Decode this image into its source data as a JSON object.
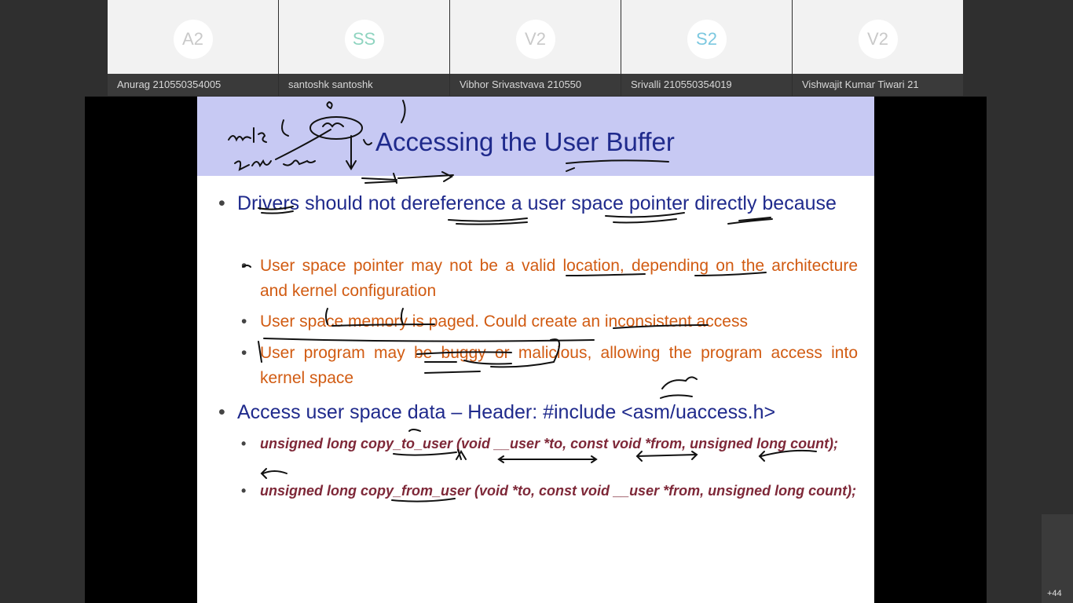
{
  "participants": [
    {
      "initials": "A2",
      "name": "Anurag 210550354005"
    },
    {
      "initials": "SS",
      "name": "santoshk santoshk"
    },
    {
      "initials": "V2",
      "name": "Vibhor Srivastvava 210550"
    },
    {
      "initials": "S2",
      "name": "Srivalli 210550354019"
    },
    {
      "initials": "V2",
      "name": "Vishwajit Kumar Tiwari 21"
    }
  ],
  "slide": {
    "title": "Accessing the User Buffer",
    "bullet1": "Drivers should not dereference a user space pointer directly because",
    "sub": [
      "User space pointer may not be a valid location, depending on the architecture and kernel configuration",
      "User space memory is paged. Could create an inconsistent access",
      "User program may be buggy or malicious, allowing the program access into kernel space"
    ],
    "bullet2": "Access user space data – Header: #include <asm/uaccess.h>",
    "code": [
      "unsigned long copy_to_user (void __user *to, const void *from, unsigned long count);",
      "unsigned long copy_from_user (void *to, const void __user *from, unsigned long count);"
    ]
  },
  "more_participants": "+44",
  "colors": {
    "title": "#1f2a8c",
    "sub_bullet": "#d15b12",
    "code": "#7e2838",
    "header_band": "#c7c9f3"
  }
}
